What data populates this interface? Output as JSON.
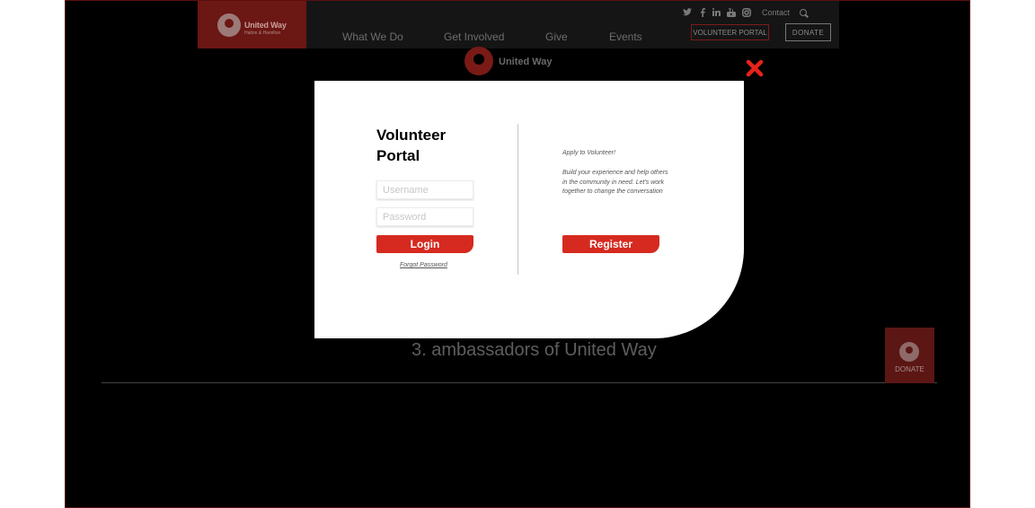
{
  "header": {
    "logo": {
      "name": "United Way",
      "sub": "Halton & Hamilton"
    },
    "nav": [
      {
        "label": "What We Do"
      },
      {
        "label": "Get Involved"
      },
      {
        "label": "Give"
      },
      {
        "label": "Events"
      }
    ],
    "social_icons": [
      "twitter-icon",
      "facebook-icon",
      "linkedin-icon",
      "youtube-icon",
      "instagram-icon"
    ],
    "contact_label": "Contact",
    "volunteer_portal_label": "VOLUNTEER PORTAL",
    "donate_label": "DONATE"
  },
  "hero": {
    "logo_text": "United Way",
    "ambassadors_line": "3.  ambassadors of United Way"
  },
  "floating_donate": {
    "label": "DONATE"
  },
  "modal": {
    "title_line1": "Volunteer",
    "title_line2": "Portal",
    "username_placeholder": "Username",
    "password_placeholder": "Password",
    "login_label": "Login",
    "forgot_label": "Forgot Password",
    "apply_label": "Apply to Volunteer!",
    "description": "Build your experience and help others in the community in need. Let's work together to change the conversation",
    "register_label": "Register"
  },
  "colors": {
    "accent_red": "#d62a20",
    "close_red": "#e8231a",
    "background": "#000000",
    "nav_bar": "#151515",
    "logo_box": "#6b1714"
  }
}
